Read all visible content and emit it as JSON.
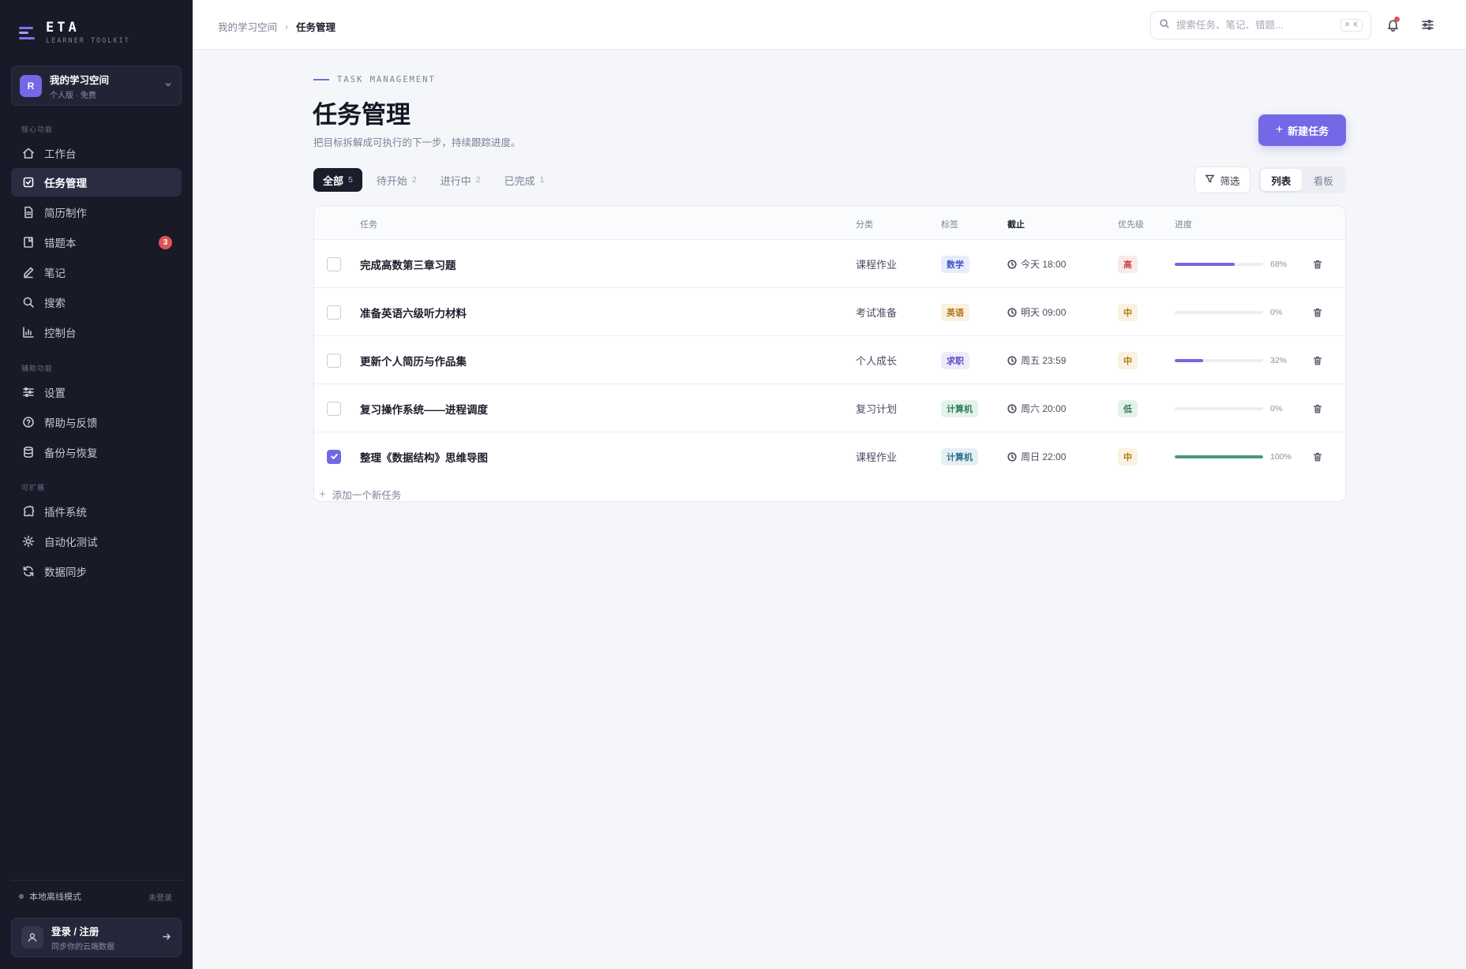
{
  "brand": {
    "name": "ETA",
    "subtitle": "LEARNER TOOLKIT"
  },
  "workspace": {
    "avatar_letter": "R",
    "name": "我的学习空间",
    "plan": "个人版 · 免费"
  },
  "sidebar": {
    "sections": [
      {
        "label": "核心功能",
        "items": [
          {
            "label": "工作台",
            "icon": "home-icon"
          },
          {
            "label": "任务管理",
            "icon": "task-check-icon",
            "active": true
          },
          {
            "label": "简历制作",
            "icon": "document-icon"
          },
          {
            "label": "错题本",
            "icon": "notebook-icon",
            "badge": "3"
          },
          {
            "label": "笔记",
            "icon": "pen-icon"
          },
          {
            "label": "搜索",
            "icon": "search-icon"
          },
          {
            "label": "控制台",
            "icon": "bar-chart-icon"
          }
        ]
      },
      {
        "label": "辅助功能",
        "items": [
          {
            "label": "设置",
            "icon": "sliders-icon"
          },
          {
            "label": "帮助与反馈",
            "icon": "help-circle-icon"
          },
          {
            "label": "备份与恢复",
            "icon": "database-icon"
          }
        ]
      },
      {
        "label": "可扩展",
        "items": [
          {
            "label": "插件系统",
            "icon": "puzzle-icon"
          },
          {
            "label": "自动化测试",
            "icon": "gear-bug-icon"
          },
          {
            "label": "数据同步",
            "icon": "refresh-icon"
          }
        ]
      }
    ],
    "status": {
      "offline_label": "本地离线模式",
      "login_state": "未登录"
    },
    "login": {
      "title": "登录 / 注册",
      "subtitle": "同步你的云端数据"
    }
  },
  "topbar": {
    "breadcrumb": {
      "root": "我的学习空间",
      "current": "任务管理"
    },
    "search": {
      "placeholder": "搜索任务、笔记、错题...",
      "shortcut": "⌘ K"
    }
  },
  "page": {
    "eyebrow": "TASK MANAGEMENT",
    "title": "任务管理",
    "subtitle": "把目标拆解成可执行的下一步，持续跟踪进度。",
    "new_button": "新建任务",
    "tabs": [
      {
        "label": "全部",
        "count": "5",
        "active": true
      },
      {
        "label": "待开始",
        "count": "2"
      },
      {
        "label": "进行中",
        "count": "2"
      },
      {
        "label": "已完成",
        "count": "1"
      }
    ],
    "filter_label": "筛选",
    "view_options": [
      {
        "label": "列表",
        "active": true
      },
      {
        "label": "看板"
      }
    ]
  },
  "table": {
    "columns": {
      "task": "任务",
      "category": "分类",
      "tag": "标签",
      "due": "截止",
      "priority": "优先级",
      "progress": "进度"
    },
    "rows": [
      {
        "title": "完成高数第三章习题",
        "category": "课程作业",
        "tag": "数学",
        "tag_color": "#3d55c8",
        "tag_bg": "#e8ecfb",
        "due": "今天 18:00",
        "priority": "高",
        "prio_color": "#c84a4a",
        "prio_bg": "#fbe9e9",
        "progress": 68,
        "progress_label": "68%",
        "bar_color": "#7468e6",
        "done": false
      },
      {
        "title": "准备英语六级听力材料",
        "category": "考试准备",
        "tag": "英语",
        "tag_color": "#b0761c",
        "tag_bg": "#fbf1e0",
        "due": "明天 09:00",
        "priority": "中",
        "prio_color": "#b0761c",
        "prio_bg": "#fbf1e0",
        "progress": 0,
        "progress_label": "0%",
        "bar_color": "#7468e6",
        "done": false
      },
      {
        "title": "更新个人简历与作品集",
        "category": "个人成长",
        "tag": "求职",
        "tag_color": "#5b49c8",
        "tag_bg": "#ecebfb",
        "due": "周五 23:59",
        "priority": "中",
        "prio_color": "#b0761c",
        "prio_bg": "#fbf1e0",
        "progress": 32,
        "progress_label": "32%",
        "bar_color": "#7468e6",
        "done": false
      },
      {
        "title": "复习操作系统——进程调度",
        "category": "复习计划",
        "tag": "计算机",
        "tag_color": "#2f7d5b",
        "tag_bg": "#e3f3ea",
        "due": "周六 20:00",
        "priority": "低",
        "prio_color": "#2f7d5b",
        "prio_bg": "#e3f3ea",
        "progress": 0,
        "progress_label": "0%",
        "bar_color": "#7468e6",
        "done": false
      },
      {
        "title": "整理《数据结构》思维导图",
        "category": "课程作业",
        "tag": "计算机",
        "tag_color": "#2f6f8a",
        "tag_bg": "#e4f0f5",
        "due": "周日 22:00",
        "priority": "中",
        "prio_color": "#b0761c",
        "prio_bg": "#fbf1e0",
        "progress": 100,
        "progress_label": "100%",
        "bar_color": "#4a9a76",
        "done": true
      }
    ],
    "add_label": "添加一个新任务"
  },
  "colors": {
    "accent": "#7468e6",
    "sidebar_bg": "#181a27",
    "badge": "#e05353"
  }
}
